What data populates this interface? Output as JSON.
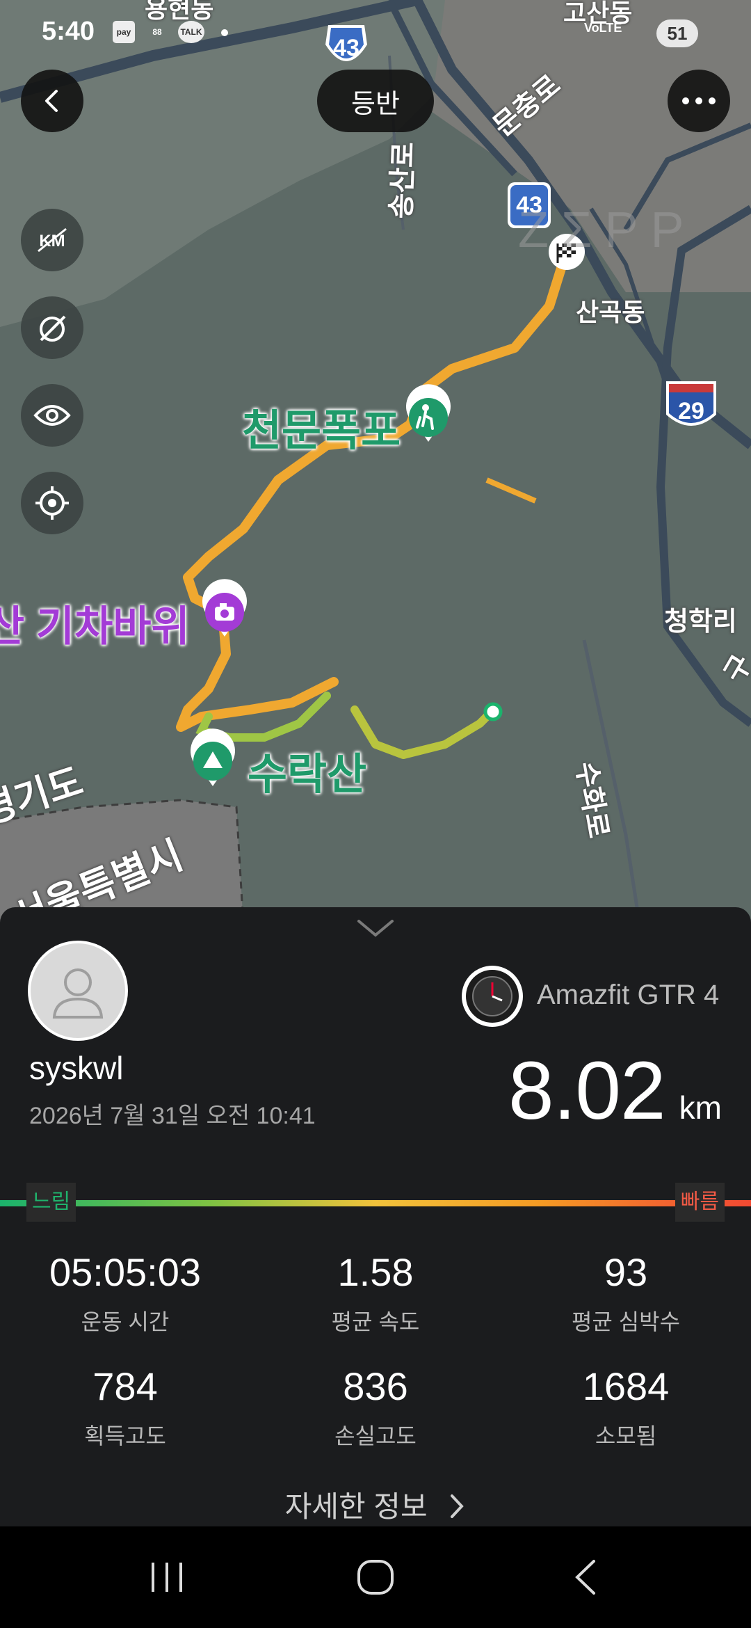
{
  "status_bar": {
    "time": "5:40",
    "icons": [
      "pay",
      "88",
      "TALK"
    ],
    "network": "VoLTE",
    "battery": "51"
  },
  "map": {
    "activity_type": "등반",
    "watermark": "ZΣPP",
    "labels": {
      "place_top": "용현동",
      "place_top_right": "고산동",
      "waterfall": "천문폭포",
      "photo_spot": "산 기차바위",
      "mountain": "수락산",
      "sangok": "산곡동",
      "cheonghak": "청학리",
      "gyeonggi": "경기도",
      "seoul": "서울특별시",
      "road_songsan": "송산로",
      "road_mun": "문충로",
      "road_suhwa": "수화로",
      "road_gu": "구"
    },
    "road_badges": [
      "43",
      "43",
      "29"
    ],
    "side_buttons": [
      "km-off-icon",
      "speed-off-icon",
      "eye-icon",
      "locate-icon"
    ]
  },
  "summary": {
    "username": "syskwl",
    "datetime": "2026년 7월 31일 오전 10:41",
    "device": "Amazfit GTR 4",
    "distance_value": "8.02",
    "distance_unit": "km",
    "slow_label": "느림",
    "fast_label": "빠름",
    "stats": [
      {
        "value": "05:05:03",
        "label": "운동 시간"
      },
      {
        "value": "1.58",
        "label": "평균 속도"
      },
      {
        "value": "93",
        "label": "평균 심박수"
      },
      {
        "value": "784",
        "label": "획득고도"
      },
      {
        "value": "836",
        "label": "손실고도"
      },
      {
        "value": "1684",
        "label": "소모됨"
      }
    ],
    "more_label": "자세한 정보"
  },
  "colors": {
    "route_slow": "#7fc243",
    "route_fast": "#f49a24",
    "accent_green": "#1f9a6a",
    "accent_purple": "#a33bd6"
  }
}
